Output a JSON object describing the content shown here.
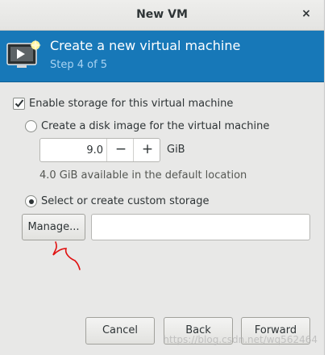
{
  "window": {
    "title": "New VM",
    "close_glyph": "×"
  },
  "header": {
    "title": "Create a new virtual machine",
    "step": "Step 4 of 5",
    "icon": "monitor-star-icon",
    "bg_color": "#1778b8"
  },
  "storage": {
    "enable_label": "Enable storage for this virtual machine",
    "enable_checked": true,
    "create_disk_label": "Create a disk image for the virtual machine",
    "create_disk_selected": false,
    "size_value": "9.0",
    "size_unit": "GiB",
    "minus_glyph": "−",
    "plus_glyph": "+",
    "available_text": "4.0 GiB available in the default location",
    "custom_label": "Select or create custom storage",
    "custom_selected": true,
    "manage_label": "Manage...",
    "custom_path_value": ""
  },
  "buttons": {
    "cancel": "Cancel",
    "back": "Back",
    "forward": "Forward"
  },
  "watermark": "https://blog.csdn.net/wq562464",
  "annotation_color": "#e01010"
}
